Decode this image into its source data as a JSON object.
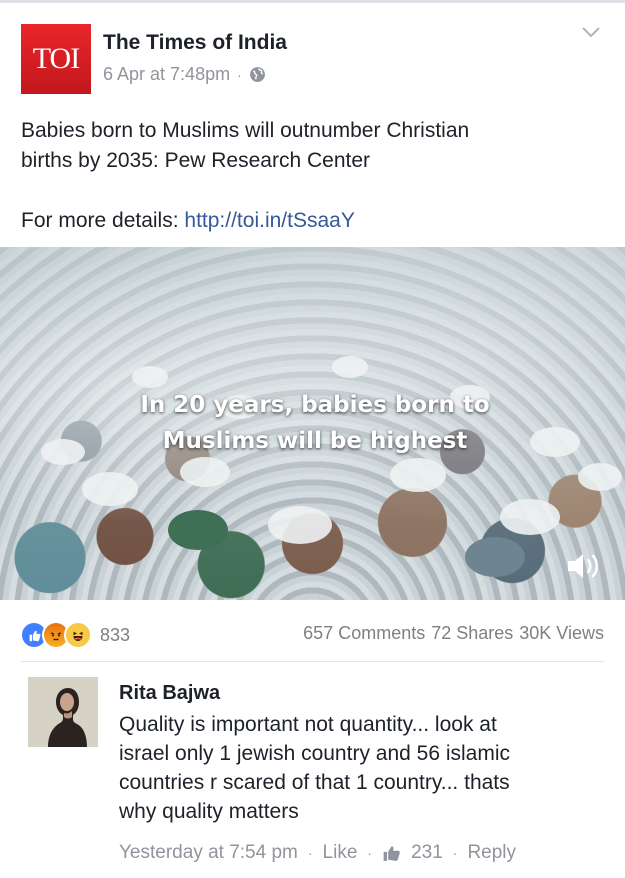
{
  "post": {
    "page_logo": "TOI",
    "page_name": "The Times of India",
    "timestamp": "6 Apr at 7:48pm",
    "separator": "·",
    "text_line_1": "Babies born to Muslims will outnumber Christian",
    "text_line_2": "births by 2035: Pew Research Center",
    "details_label": "For more details:",
    "details_link": "http://toi.in/tSsaaY"
  },
  "video": {
    "overlay_line_1": "In 20 years, babies born to",
    "overlay_line_2": "Muslims will be highest"
  },
  "stats": {
    "reactions_count": "833",
    "comments": "657 Comments",
    "shares": "72 Shares",
    "views": "30K Views"
  },
  "comment": {
    "author": "Rita Bajwa",
    "text_line_1": "Quality is important not quantity... look at",
    "text_line_2": "israel only 1 jewish country and 56 islamic",
    "text_line_3": "countries r scared of that 1 country... thats",
    "text_line_4": "why quality matters",
    "time": "Yesterday at 7:54 pm",
    "like_label": "Like",
    "likes_count": "231",
    "reply_label": "Reply",
    "dot": "·"
  },
  "colors": {
    "link": "#365899",
    "brand_red": "#e8262b",
    "meta_grey": "#90949c",
    "like_blue": "#4080ff"
  },
  "icons": [
    "globe-icon",
    "chevron-down-icon",
    "sound-icon",
    "like-reaction-icon",
    "angry-reaction-icon",
    "haha-reaction-icon",
    "thumbs-up-icon"
  ]
}
